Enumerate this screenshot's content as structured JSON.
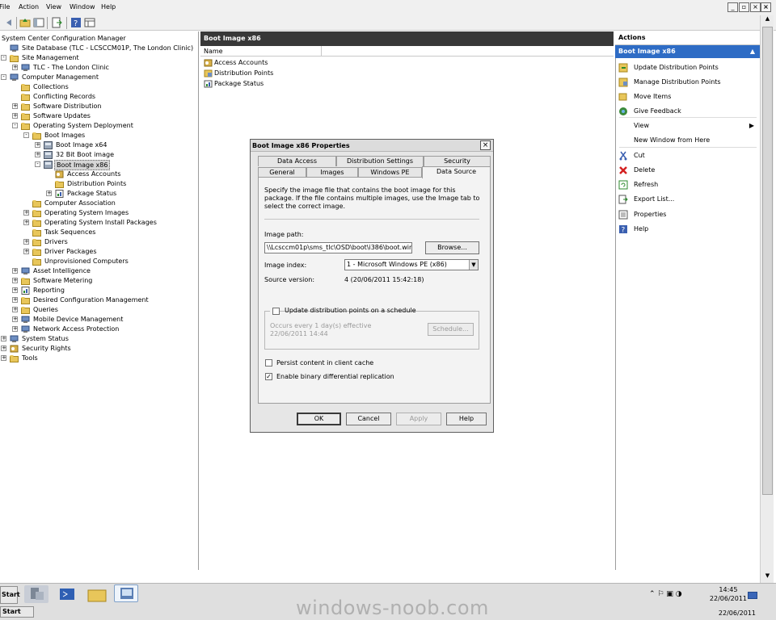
{
  "menu": {
    "file": "File",
    "action": "Action",
    "view": "View",
    "window": "Window",
    "help": "Help"
  },
  "tree": [
    "System Center Configuration Manager",
    "Site Database  (TLC - LCSCCM01P, The London Clinic)",
    "Site Management",
    "TLC - The London Clinic",
    "Computer Management",
    "Collections",
    "Conflicting Records",
    "Software Distribution",
    "Software Updates",
    "Operating System Deployment",
    "Boot Images",
    "Boot Image x64",
    "32 Bit Boot image",
    "Boot Image x86",
    "Access Accounts",
    "Distribution Points",
    "Package Status",
    "Computer Association",
    "Operating System Images",
    "Operating System Install Packages",
    "Task Sequences",
    "Drivers",
    "Driver Packages",
    "Unprovisioned Computers",
    "Asset Intelligence",
    "Software Metering",
    "Reporting",
    "Desired Configuration Management",
    "Queries",
    "Mobile Device Management",
    "Network Access Protection",
    "System Status",
    "Security Rights",
    "Tools"
  ],
  "middle": {
    "title": "Boot Image x86",
    "column_name": "Name",
    "rows": [
      "Access Accounts",
      "Distribution Points",
      "Package Status"
    ]
  },
  "actions": {
    "header": "Actions",
    "subheader": "Boot Image x86",
    "items": [
      "Update Distribution Points",
      "Manage Distribution Points",
      "Move Items",
      "Give Feedback",
      "View",
      "New Window from Here",
      "Cut",
      "Delete",
      "Refresh",
      "Export List...",
      "Properties",
      "Help"
    ]
  },
  "dialog": {
    "title": "Boot Image x86 Properties",
    "close": "×",
    "tabs_row1": [
      "Data Access",
      "Distribution Settings",
      "Security"
    ],
    "tabs_row2": [
      "General",
      "Images",
      "Windows PE",
      "Data Source"
    ],
    "description": "Specify the image file that contains the boot image for this package. If the file contains multiple images, use the Image tab to select the correct image.",
    "image_path_label": "Image path:",
    "image_path_value": "\\\\Lcsccm01p\\sms_tlc\\OSD\\boot\\i386\\boot.wim",
    "browse": "Browse...",
    "image_index_label": "Image index:",
    "image_index_value": "1 - Microsoft Windows PE (x86)",
    "source_version_label": "Source version:",
    "source_version_value": "4 (20/06/2011 15:42:18)",
    "schedule_checkbox": "Update distribution points on a schedule",
    "schedule_text": "Occurs every 1 day(s) effective 22/06/2011 14:44",
    "schedule_button": "Schedule...",
    "persist": "Persist content in client cache",
    "persist_checked": false,
    "binary_diff": "Enable binary differential replication",
    "binary_diff_checked": true,
    "check_mark": "✓",
    "ok": "OK",
    "cancel": "Cancel",
    "apply": "Apply",
    "help": "Help"
  },
  "taskbar": {
    "start": "Start",
    "time": "14:45",
    "date": "22/06/2011",
    "date2": "22/06/2011"
  },
  "watermark": "windows-noob.com",
  "icons": {
    "folder": "folder-icon",
    "computer": "computer-icon",
    "boot": "boot-image-icon",
    "page": "page-icon",
    "key": "key-icon",
    "refresh": "refresh-icon",
    "delete": "delete-icon",
    "help": "help-icon",
    "cut": "cut-icon",
    "export": "export-icon",
    "properties": "properties-icon"
  },
  "colors": {
    "actions_header": "#2e6cc5",
    "middle_header": "#383838",
    "delete": "#d42020"
  }
}
